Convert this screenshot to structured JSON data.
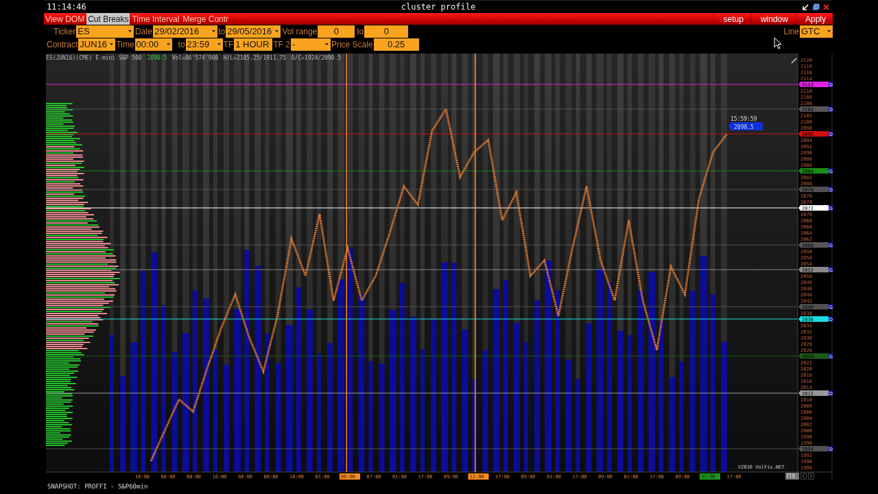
{
  "title_bar": {
    "time": "11:14:46",
    "title": "cluster profile"
  },
  "menu": [
    {
      "label": "View DOM",
      "selected": false
    },
    {
      "label": "Cut Breaks",
      "selected": true
    },
    {
      "label": "Time Interval",
      "selected": false
    },
    {
      "label": "Merge Contr",
      "selected": false
    }
  ],
  "menu_right": [
    "setup",
    "window",
    "Apply"
  ],
  "filter_rows": [
    [
      {
        "kind": "label",
        "text": "Ticker"
      },
      {
        "kind": "dropdown",
        "value": "ES"
      },
      {
        "kind": "label",
        "text": "Date"
      },
      {
        "kind": "dropdown",
        "value": "29/02/2016"
      },
      {
        "kind": "label",
        "text": "to"
      },
      {
        "kind": "dropdown",
        "value": "29/05/2016"
      },
      {
        "kind": "label",
        "text": "Vol range"
      },
      {
        "kind": "number",
        "value": "0"
      },
      {
        "kind": "label",
        "text": "to"
      },
      {
        "kind": "number",
        "value": "0"
      }
    ],
    [
      {
        "kind": "label",
        "text": "Contract"
      },
      {
        "kind": "dropdown",
        "value": "JUN16"
      },
      {
        "kind": "label",
        "text": "Time"
      },
      {
        "kind": "dropdown",
        "value": "00:00"
      },
      {
        "kind": "label",
        "text": "to"
      },
      {
        "kind": "dropdown",
        "value": "23:59"
      },
      {
        "kind": "label",
        "text": "TF"
      },
      {
        "kind": "dropdown",
        "value": "1 HOUR"
      },
      {
        "kind": "label",
        "text": "TF 2"
      },
      {
        "kind": "dropdown",
        "value": "-"
      },
      {
        "kind": "label",
        "text": "Price Scale"
      },
      {
        "kind": "number",
        "value": "0.25"
      }
    ]
  ],
  "line_selector": {
    "label": "Line",
    "value": "GTC"
  },
  "chart": {
    "info": [
      {
        "text": "ES(JUN16)(CME) E-mini S&P 500"
      },
      {
        "text": "2090.5",
        "color": "#2ecc40"
      },
      {
        "text": "Vol=06'574'900"
      },
      {
        "text": "H/L=2105.25/1911.75"
      },
      {
        "text": "O/C=1924/2090.5"
      }
    ],
    "price_axis": [
      "2120",
      "2118",
      "2116",
      "2114",
      "2110",
      "2108",
      "2106",
      "2102",
      "2100",
      "2098",
      "2094",
      "2092",
      "2090",
      "2088",
      "2086",
      "2082",
      "2080",
      "2076",
      "2074",
      "2070",
      "2068",
      "2066",
      "2064",
      "2062",
      "2058",
      "2056",
      "2054",
      "2050",
      "2048",
      "2046",
      "2044",
      "2042",
      "2038",
      "2034",
      "2032",
      "2030",
      "2028",
      "2026",
      "2022",
      "2020",
      "2018",
      "2016",
      "2014",
      "2010",
      "2008",
      "2006",
      "2004",
      "2002",
      "2000",
      "1998",
      "1996",
      "1992",
      "1990",
      "1988"
    ],
    "price_levels": [
      {
        "label": "2112",
        "color": "#e020e0",
        "flag": "D"
      },
      {
        "label": "2104",
        "color": "#555555",
        "flag": "D"
      },
      {
        "label": "2096",
        "color": "#d01010",
        "flag": "D"
      },
      {
        "label": "2084",
        "color": "#1a8a1a",
        "flag": "G"
      },
      {
        "label": "2078",
        "color": "#505050",
        "flag": "D"
      },
      {
        "label": "2072",
        "color": "#ffffff",
        "flag": "G"
      },
      {
        "label": "2060",
        "color": "#555555",
        "flag": "G"
      },
      {
        "label": "2052",
        "color": "#888888",
        "flag": "G"
      },
      {
        "label": "2040",
        "color": "#505050",
        "flag": "G"
      },
      {
        "label": "2036",
        "color": "#19e0e0",
        "flag": "D"
      },
      {
        "label": "2024",
        "color": "#1a5a1a",
        "flag": "G"
      },
      {
        "label": "2012",
        "color": "#999999",
        "flag": "D"
      },
      {
        "label": "1994",
        "color": "#505050",
        "flag": "D"
      }
    ],
    "price_callout": {
      "time": "15:59:59",
      "price": "2098.5"
    },
    "time_labels": [
      {
        "label": "16:00"
      },
      {
        "label": "06:00"
      },
      {
        "label": "00:00"
      },
      {
        "label": "16:00"
      },
      {
        "label": "08:00"
      },
      {
        "label": "00:00"
      },
      {
        "label": "16:00"
      },
      {
        "label": "01:00"
      },
      {
        "label": "06:00",
        "color": "#ff8c1a",
        "session_line": true
      },
      {
        "label": "07:00"
      },
      {
        "label": "01:00"
      },
      {
        "label": "17:00"
      },
      {
        "label": "09:00"
      },
      {
        "label": "12:00",
        "color": "#ff8c1a",
        "session_line": true
      },
      {
        "label": "17:00"
      },
      {
        "label": "09:00"
      },
      {
        "label": "01:00"
      },
      {
        "label": "17:00"
      },
      {
        "label": "09:00"
      },
      {
        "label": "01:00"
      },
      {
        "label": "17:00"
      },
      {
        "label": "09:00"
      },
      {
        "label": "03:00",
        "color": "#1a9a1a",
        "session_line": false
      },
      {
        "label": "17:00"
      }
    ],
    "copyright": "©2016 VolFix.NET",
    "fix_button": "FIX"
  },
  "status_bar": "SNAPSHOT: PROFFI - S&P60min"
}
